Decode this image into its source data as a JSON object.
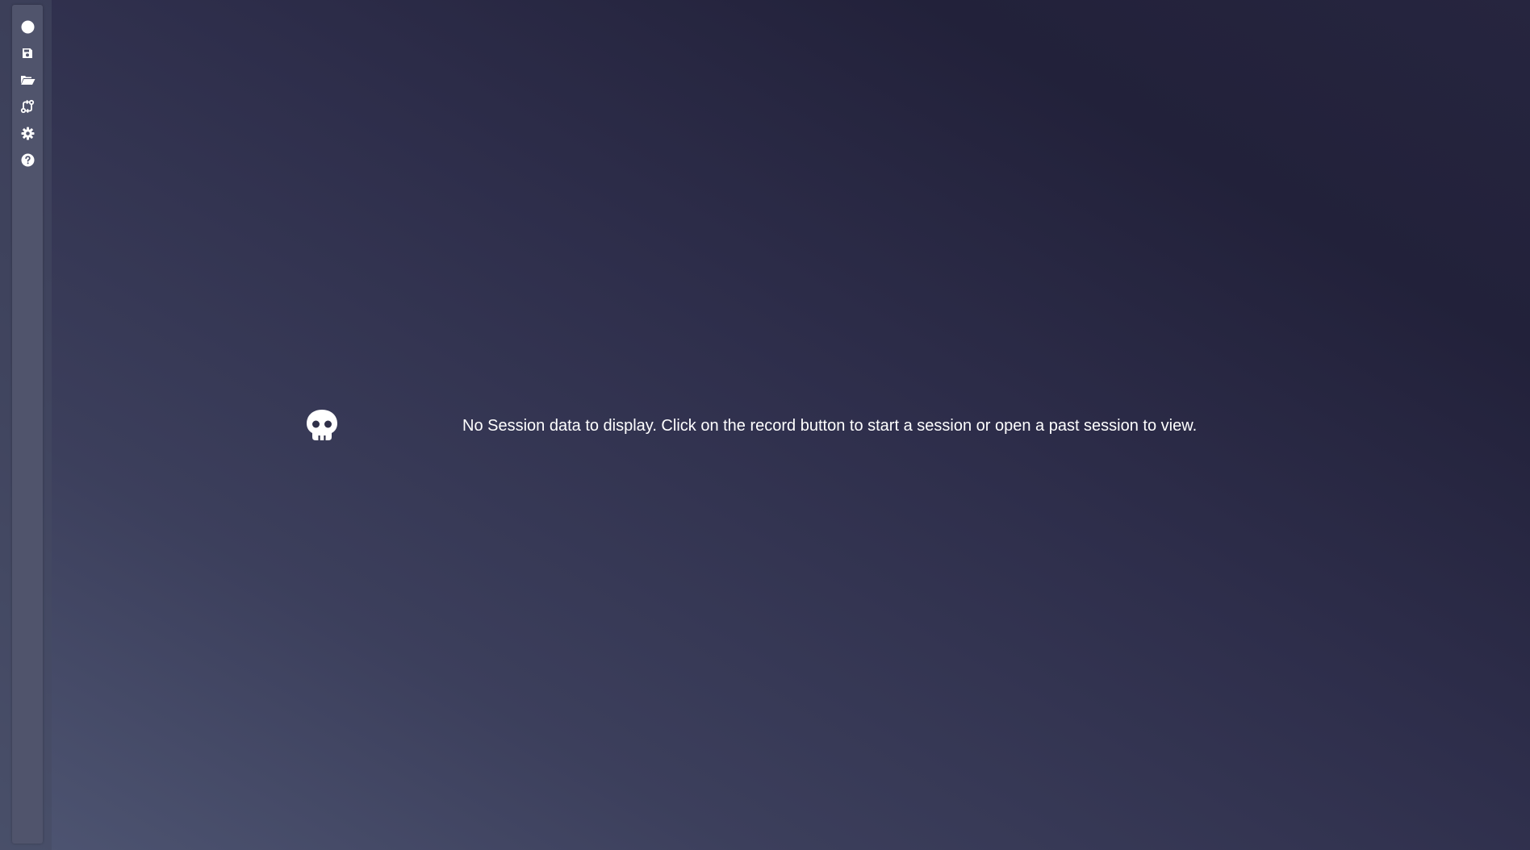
{
  "sidebar": {
    "items": [
      {
        "icon": "record-icon",
        "action": "record"
      },
      {
        "icon": "save-icon",
        "action": "save"
      },
      {
        "icon": "folder-open-icon",
        "action": "open"
      },
      {
        "icon": "compare-icon",
        "action": "compare"
      },
      {
        "icon": "gear-icon",
        "action": "settings"
      },
      {
        "icon": "help-icon",
        "action": "help"
      }
    ]
  },
  "main": {
    "empty_state": {
      "icon": "skull-icon",
      "message": "No Session data to display. Click on the record button to start a session or open a past session to view."
    }
  },
  "colors": {
    "icon": "#ffffff",
    "sidebar": "#50546c",
    "background_light": "#4e5572",
    "background_dark": "#22213a"
  }
}
